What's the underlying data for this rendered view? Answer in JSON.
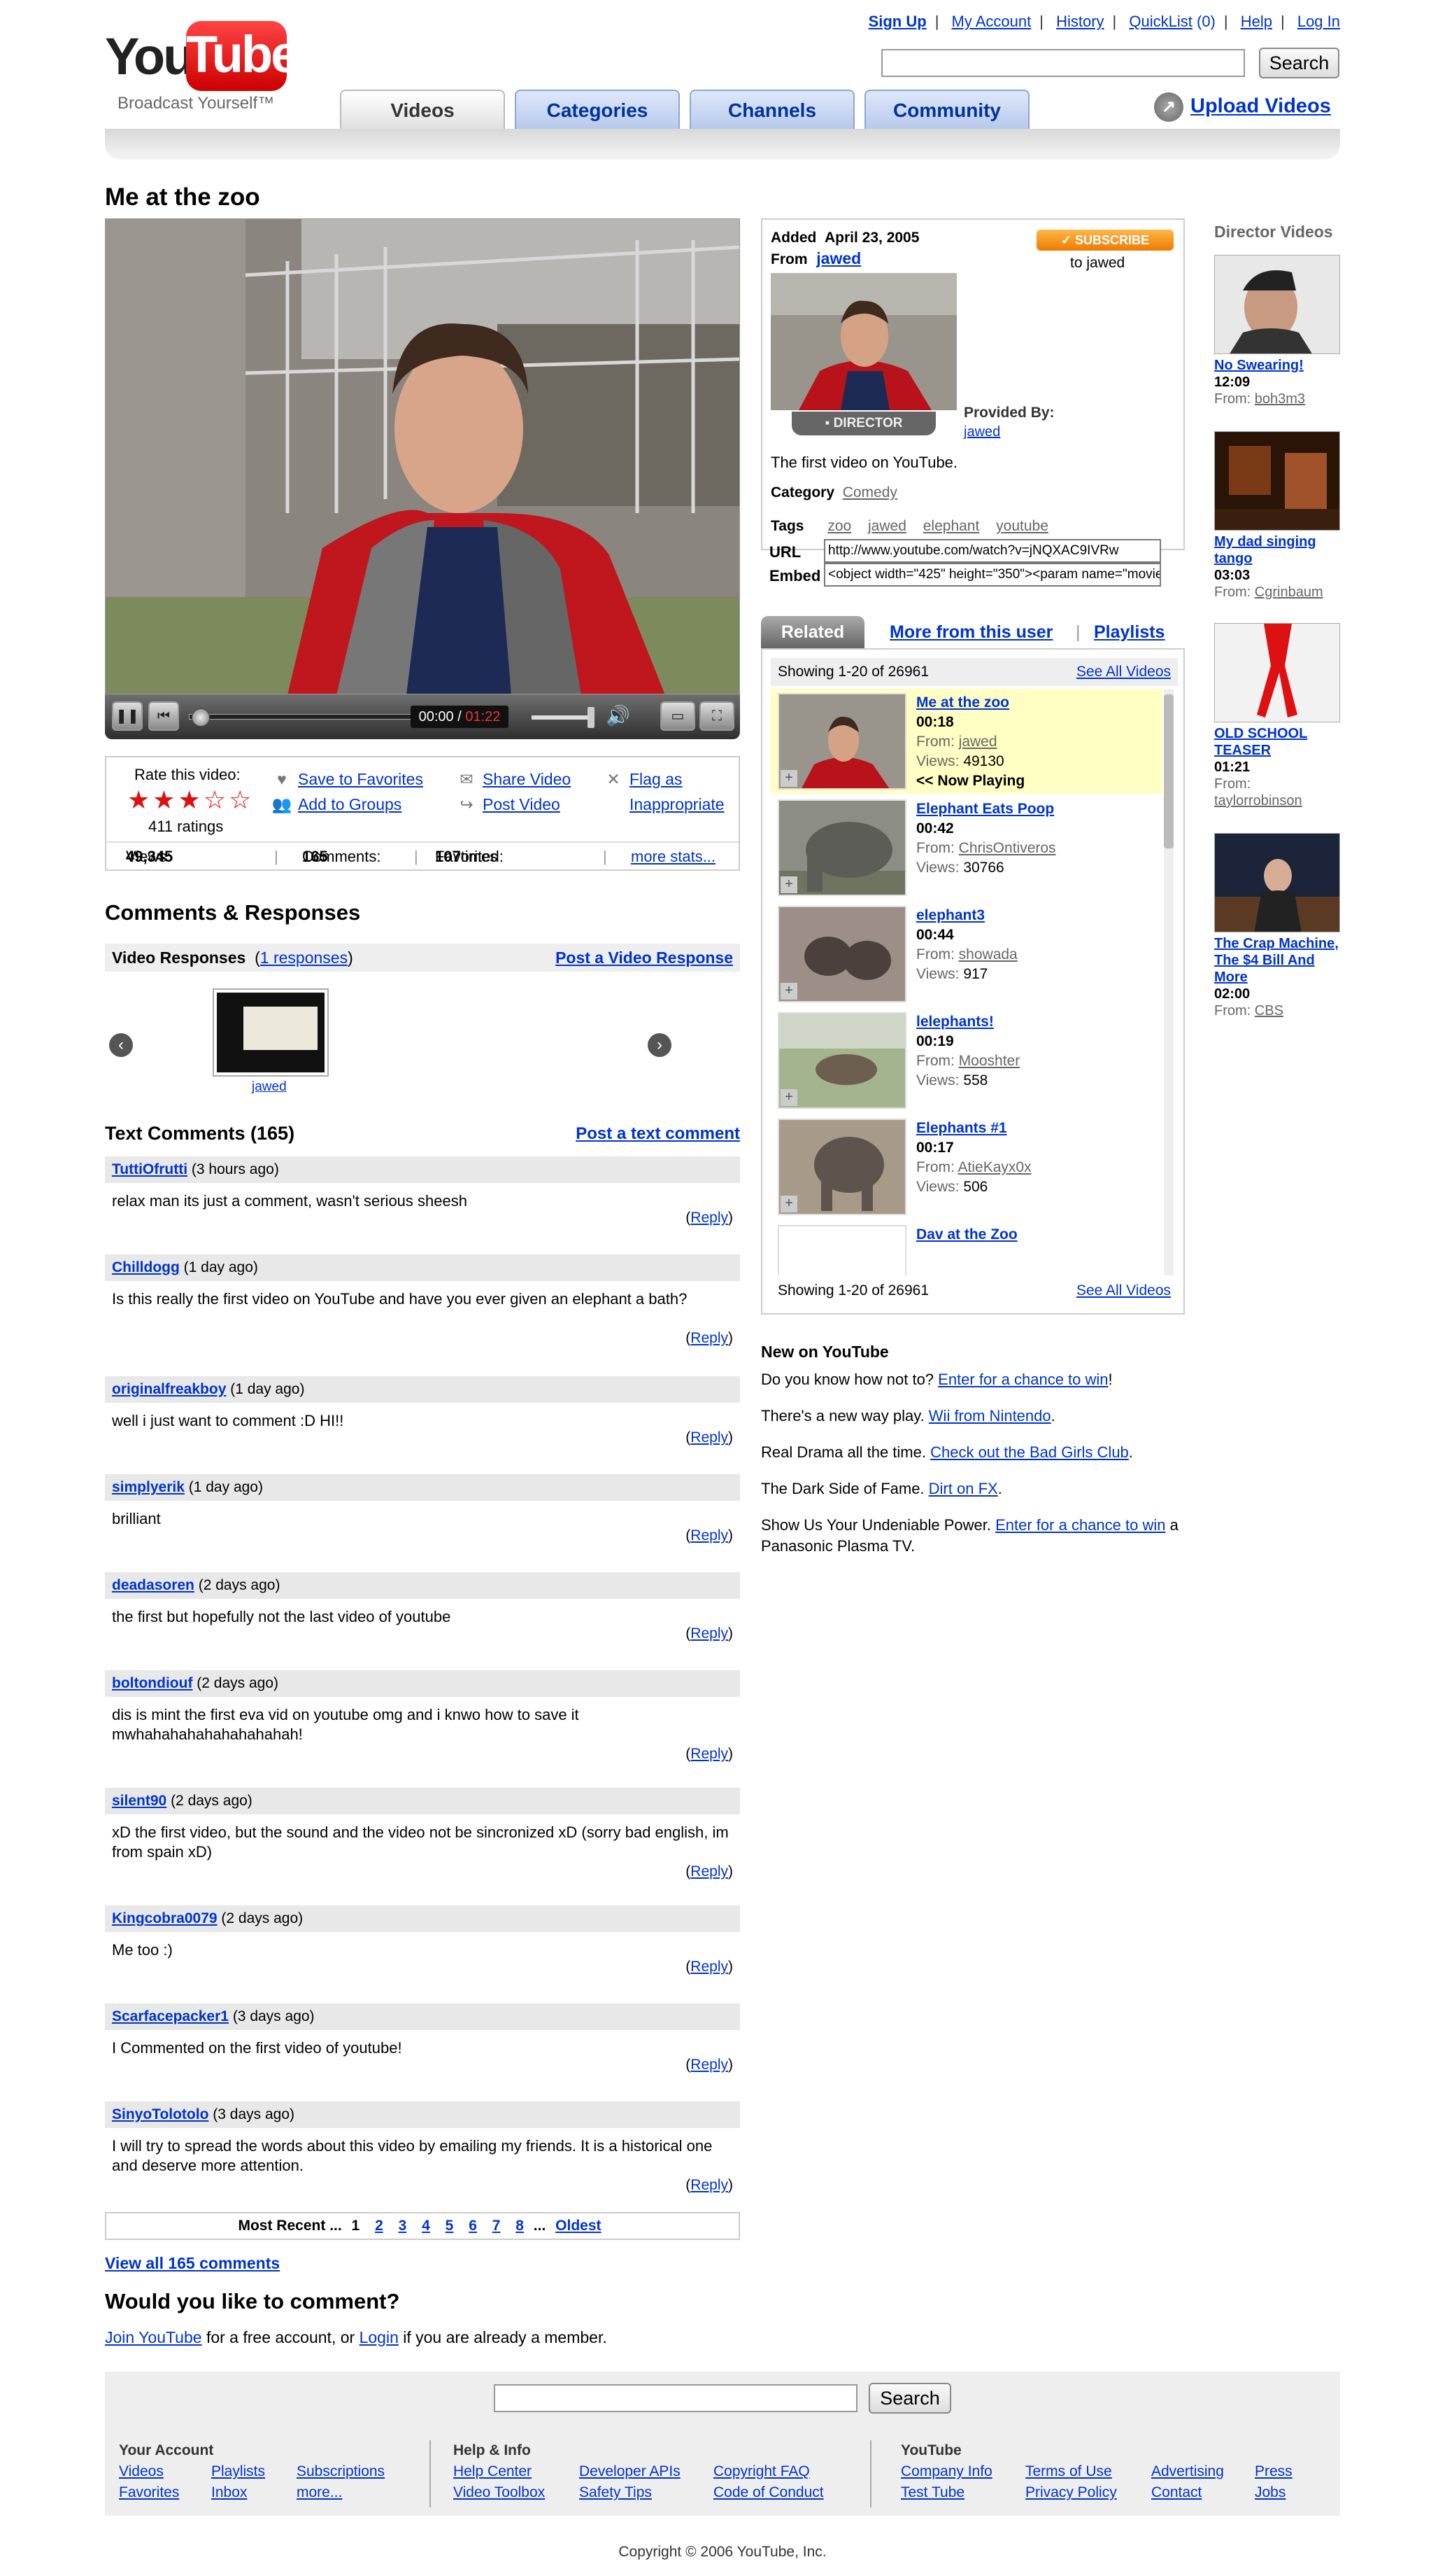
{
  "header": {
    "logo_you": "You",
    "logo_tube": "Tube",
    "tagline": "Broadcast Yourself™",
    "nav": [
      "Sign Up",
      "My Account",
      "History",
      "QuickList",
      "(0)",
      "Help",
      "Log In"
    ],
    "search_button": "Search",
    "tabs": [
      "Videos",
      "Categories",
      "Channels",
      "Community"
    ],
    "upload": "Upload Videos"
  },
  "video": {
    "title": "Me at the zoo",
    "time_current": "00:00",
    "time_sep": " / ",
    "time_total": "01:22",
    "rate_label": "Rate this video:",
    "stars": "★★★☆☆",
    "ratings": "411 ratings",
    "actions": [
      "Save to Favorites",
      "Add to Groups",
      "Share Video",
      "Post Video",
      "Flag as",
      "Inappropriate"
    ],
    "views_label": "Views:",
    "views": "49,345",
    "comments_label": "Comments:",
    "comments": "165",
    "favorited_label": "Favorited:",
    "favorited": "107",
    "favorited_suffix": "times",
    "more_stats": "more stats..."
  },
  "responses": {
    "heading": "Comments & Responses",
    "label": "Video Responses",
    "count_open": "(",
    "count_link": "1 responses",
    "count_close": ")",
    "post": "Post a Video Response",
    "thumb_user": "jawed"
  },
  "text_comments": {
    "heading": "Text Comments (165)",
    "post": "Post a text comment",
    "reply": "Reply",
    "items": [
      {
        "user": "TuttiOfrutti",
        "when": "(3 hours ago)",
        "text": "relax man its just a comment, wasn't serious sheesh"
      },
      {
        "user": "Chilldogg",
        "when": "(1 day ago)",
        "text": "Is this really the first video on YouTube and have you ever given an elephant a bath?"
      },
      {
        "user": "originalfreakboy",
        "when": "(1 day ago)",
        "text": "well i just want to comment :D HI!!"
      },
      {
        "user": "simplyerik",
        "when": "(1 day ago)",
        "text": "brilliant"
      },
      {
        "user": "deadasoren",
        "when": "(2 days ago)",
        "text": "the first but hopefully not the last video of youtube"
      },
      {
        "user": "boltondiouf",
        "when": "(2 days ago)",
        "text": "dis is mint the first eva vid on youtube omg and i knwo how to save it mwhahahahahahahahahah!"
      },
      {
        "user": "silent90",
        "when": "(2 days ago)",
        "text": "xD the first video, but the sound and the video not be sincronized xD (sorry bad english, im from spain xD)"
      },
      {
        "user": "Kingcobra0079",
        "when": "(2 days ago)",
        "text": "Me too :)"
      },
      {
        "user": "Scarfacepacker1",
        "when": "(3 days ago)",
        "text": "I Commented on the first video of youtube!"
      },
      {
        "user": "SinyoTolotolo",
        "when": "(3 days ago)",
        "text": "I will try to spread the words about this video by emailing my friends. It is a historical one and deserve more attention."
      }
    ],
    "pager": {
      "most_recent": "Most Recent",
      "dots": "...",
      "pages": [
        "1",
        "2",
        "3",
        "4",
        "5",
        "6",
        "7",
        "8"
      ],
      "oldest": "Oldest"
    },
    "view_all": "View all 165 comments",
    "would": "Would you like to comment?",
    "join": "Join YouTube",
    "join_mid": " for a free account, or ",
    "login": "Login",
    "join_end": " if you are already a member."
  },
  "info": {
    "added_label": "Added",
    "added": "April 23, 2005",
    "from_label": "From",
    "from": "jawed",
    "subscribe": "✓ SUBSCRIBE",
    "subscribe_to": "to jawed",
    "director": "DIRECTOR",
    "provided": "Provided By:",
    "provided_user": "jawed",
    "description": "The first video on YouTube.",
    "category_label": "Category",
    "category": "Comedy",
    "tags_label": "Tags",
    "tags": [
      "zoo",
      "jawed",
      "elephant",
      "youtube"
    ],
    "url_label": "URL",
    "url": "http://www.youtube.com/watch?v=jNQXAC9IVRw",
    "embed_label": "Embed",
    "embed": "<object width=\"425\" height=\"350\"><param name=\"movie\""
  },
  "related": {
    "tabs": [
      "Related",
      "More from this user",
      "Playlists"
    ],
    "showing": "Showing 1-20 of 26961",
    "see_all": "See All Videos",
    "from_label": "From:",
    "views_label": "Views:",
    "now_playing": "<< Now Playing",
    "items": [
      {
        "title": "Me at the zoo",
        "dur": "00:18",
        "from": "jawed",
        "views": "49130"
      },
      {
        "title": "Elephant Eats Poop",
        "dur": "00:42",
        "from": "ChrisOntiveros",
        "views": "30766"
      },
      {
        "title": "elephant3",
        "dur": "00:44",
        "from": "showada",
        "views": "917"
      },
      {
        "title": "lelephants!",
        "dur": "00:19",
        "from": "Mooshter",
        "views": "558"
      },
      {
        "title": "Elephants #1",
        "dur": "00:17",
        "from": "AtieKayx0x",
        "views": "506"
      },
      {
        "title": "Dav at the Zoo",
        "dur": "",
        "from": "",
        "views": ""
      }
    ]
  },
  "new_on": {
    "heading": "New on YouTube",
    "lines": [
      {
        "pre": "Do you know how not to? ",
        "link": "Enter for a chance to win",
        "post": "!"
      },
      {
        "pre": "There's a new way play. ",
        "link": "Wii from Nintendo",
        "post": "."
      },
      {
        "pre": "Real Drama all the time. ",
        "link": "Check out the Bad Girls Club",
        "post": "."
      },
      {
        "pre": "The Dark Side of Fame. ",
        "link": "Dirt on FX",
        "post": "."
      },
      {
        "pre": "Show Us Your Undeniable Power. ",
        "link": "Enter for a chance to win",
        "post": " a Panasonic Plasma TV."
      }
    ]
  },
  "director": {
    "heading": "Director Videos",
    "from_label": "From:",
    "items": [
      {
        "title": "No Swearing!",
        "dur": "12:09",
        "from": "boh3m3"
      },
      {
        "title": "My dad singing tango",
        "dur": "03:03",
        "from": "Cgrinbaum"
      },
      {
        "title": "OLD SCHOOL TEASER",
        "dur": "01:21",
        "from": "taylorrobinson"
      },
      {
        "title": "The Crap Machine, The $4 Bill And More",
        "dur": "02:00",
        "from": "CBS"
      }
    ]
  },
  "footer": {
    "search_button": "Search",
    "your_account": "Your  Account",
    "account_links": [
      "Videos",
      "Playlists",
      "Subscriptions",
      "Favorites",
      "Inbox",
      "more..."
    ],
    "help": "Help & Info",
    "help_links": [
      "Help Center",
      "Developer APIs",
      "Copyright FAQ",
      "Video Toolbox",
      "Safety Tips",
      "Code of Conduct"
    ],
    "youtube": "YouTube",
    "yt_links": [
      "Company Info",
      "Terms of Use",
      "Advertising",
      "Press",
      "Test Tube",
      "Privacy Policy",
      "Contact",
      "Jobs"
    ],
    "copyright": "Copyright © 2006 YouTube, Inc."
  },
  "colors": {
    "link": "#0033cc",
    "brand_red": "#e52d27",
    "subscribe": "#ee7a00",
    "now_playing_bg": "#ffffc4"
  }
}
